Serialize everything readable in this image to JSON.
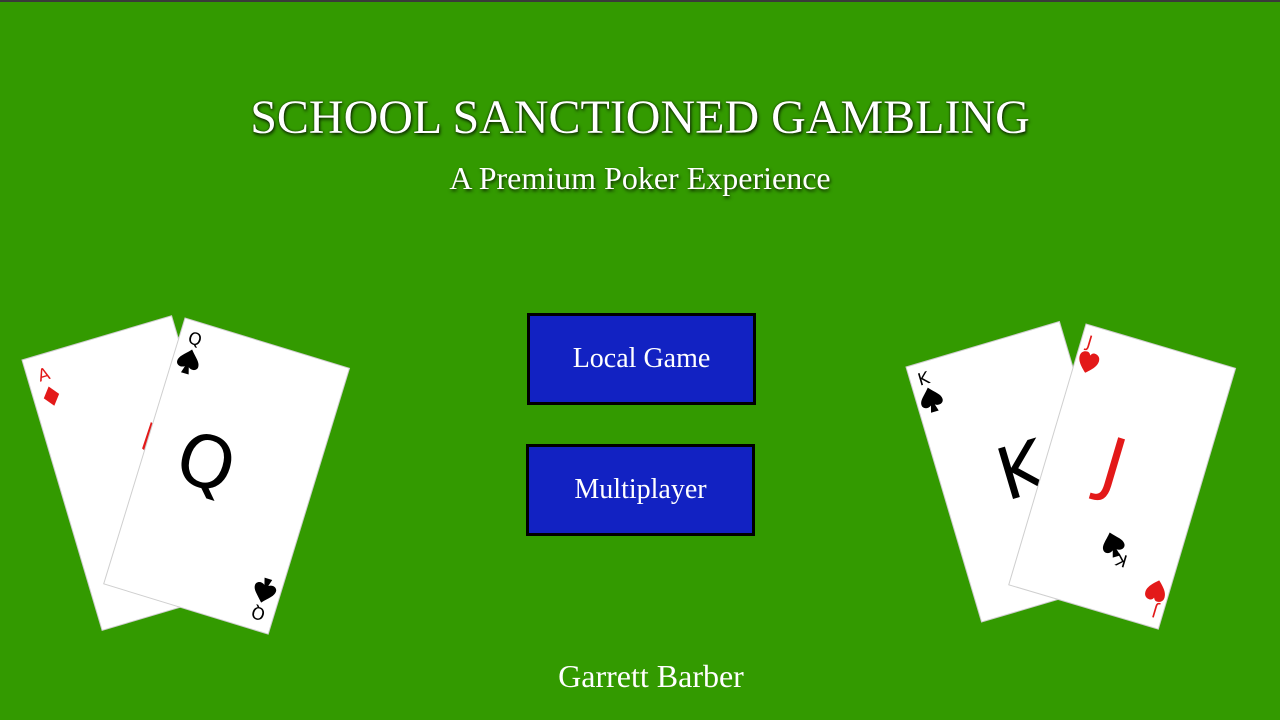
{
  "title": "SCHOOL SANCTIONED GAMBLING",
  "subtitle": "A Premium Poker Experience",
  "menu": {
    "local_game": "Local Game",
    "multiplayer": "Multiplayer"
  },
  "author": "Garrett Barber",
  "left_hand": {
    "back_card": {
      "rank": "A",
      "suit": "diamonds"
    },
    "front_card": {
      "rank": "Q",
      "suit": "spades"
    }
  },
  "right_hand": {
    "back_card": {
      "rank": "K",
      "suit": "spades"
    },
    "front_card": {
      "rank": "J",
      "suit": "hearts"
    }
  },
  "colors": {
    "table_felt": "#339a00",
    "button_fill": "#1222c2",
    "button_border": "#000000",
    "red_suit": "#e31919",
    "black_suit": "#000000"
  }
}
